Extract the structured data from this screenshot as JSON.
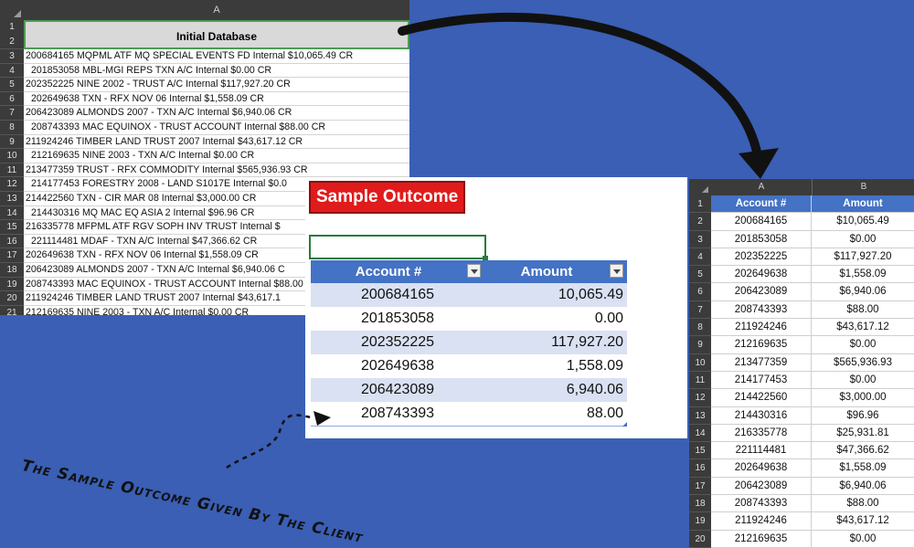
{
  "left_sheet": {
    "column_letter": "A",
    "header": "Initial Database",
    "header_row_nums": "1\n2",
    "row_numbers": [
      "3",
      "4",
      "5",
      "6",
      "7",
      "8",
      "9",
      "10",
      "11",
      "12",
      "13",
      "14",
      "15",
      "16",
      "17",
      "18",
      "19",
      "20",
      "21"
    ],
    "rows": [
      "200684165 MQPML ATF MQ SPECIAL EVENTS FD  Internal $10,065.49 CR",
      "201853058 MBL-MGI REPS TXN A/C  Internal $0.00 CR",
      "202352225 NINE 2002 - TRUST A/C  Internal $117,927.20 CR",
      "202649638 TXN - RFX NOV 06  Internal $1,558.09 CR",
      "206423089 ALMONDS 2007 - TXN A/C  Internal $6,940.06 CR",
      "208743393 MAC EQUINOX - TRUST ACCOUNT  Internal $88.00 CR",
      "211924246 TIMBER LAND TRUST 2007  Internal $43,617.12 CR",
      "212169635 NINE 2003 - TXN A/C  Internal $0.00 CR",
      "213477359 TRUST - RFX COMMODITY  Internal $565,936.93 CR",
      "214177453 FORESTRY 2008 - LAND S1017E  Internal $0.0",
      "214422560 TXN - CIR MAR 08  Internal $3,000.00 CR",
      "214430316 MQ MAC EQ ASIA 2  Internal $96.96 CR",
      "216335778 MFPML ATF RGV SOPH INV TRUST  Internal $",
      "221114481 MDAF - TXN A/C  Internal $47,366.62 CR",
      "202649638 TXN - RFX NOV 06  Internal $1,558.09 CR",
      "206423089 ALMONDS 2007 - TXN A/C  Internal $6,940.06 C",
      "208743393 MAC EQUINOX - TRUST ACCOUNT  Internal $88.00",
      "211924246 TIMBER LAND TRUST 2007  Internal $43,617.1",
      "212169635 NINE 2003 - TXN A/C  Internal $0.00 CR"
    ]
  },
  "center": {
    "badge": "Sample Outcome",
    "columns": [
      "Account #",
      "Amount"
    ],
    "rows": [
      {
        "account": "200684165",
        "amount": "10,065.49"
      },
      {
        "account": "201853058",
        "amount": "0.00"
      },
      {
        "account": "202352225",
        "amount": "117,927.20"
      },
      {
        "account": "202649638",
        "amount": "1,558.09"
      },
      {
        "account": "206423089",
        "amount": "6,940.06"
      },
      {
        "account": "208743393",
        "amount": "88.00"
      }
    ]
  },
  "right_sheet": {
    "column_letters": [
      "A",
      "B"
    ],
    "headers": [
      "Account #",
      "Amount"
    ],
    "header_row_num": "1",
    "rows": [
      {
        "num": "2",
        "account": "200684165",
        "amount": "$10,065.49"
      },
      {
        "num": "3",
        "account": "201853058",
        "amount": "$0.00"
      },
      {
        "num": "4",
        "account": "202352225",
        "amount": "$117,927.20"
      },
      {
        "num": "5",
        "account": "202649638",
        "amount": "$1,558.09"
      },
      {
        "num": "6",
        "account": "206423089",
        "amount": "$6,940.06"
      },
      {
        "num": "7",
        "account": "208743393",
        "amount": "$88.00"
      },
      {
        "num": "8",
        "account": "211924246",
        "amount": "$43,617.12"
      },
      {
        "num": "9",
        "account": "212169635",
        "amount": "$0.00"
      },
      {
        "num": "10",
        "account": "213477359",
        "amount": "$565,936.93"
      },
      {
        "num": "11",
        "account": "214177453",
        "amount": "$0.00"
      },
      {
        "num": "12",
        "account": "214422560",
        "amount": "$3,000.00"
      },
      {
        "num": "13",
        "account": "214430316",
        "amount": "$96.96"
      },
      {
        "num": "14",
        "account": "216335778",
        "amount": "$25,931.81"
      },
      {
        "num": "15",
        "account": "221114481",
        "amount": "$47,366.62"
      },
      {
        "num": "16",
        "account": "202649638",
        "amount": "$1,558.09"
      },
      {
        "num": "17",
        "account": "206423089",
        "amount": "$6,940.06"
      },
      {
        "num": "18",
        "account": "208743393",
        "amount": "$88.00"
      },
      {
        "num": "19",
        "account": "211924246",
        "amount": "$43,617.12"
      },
      {
        "num": "20",
        "account": "212169635",
        "amount": "$0.00"
      }
    ]
  },
  "caption": "The Sample Outcome Given By The Client",
  "colors": {
    "background": "#3a5fb4",
    "table_header": "#4472c4",
    "band": "#d9e1f2",
    "badge": "#e01b1b",
    "selection": "#2a7a3c"
  }
}
